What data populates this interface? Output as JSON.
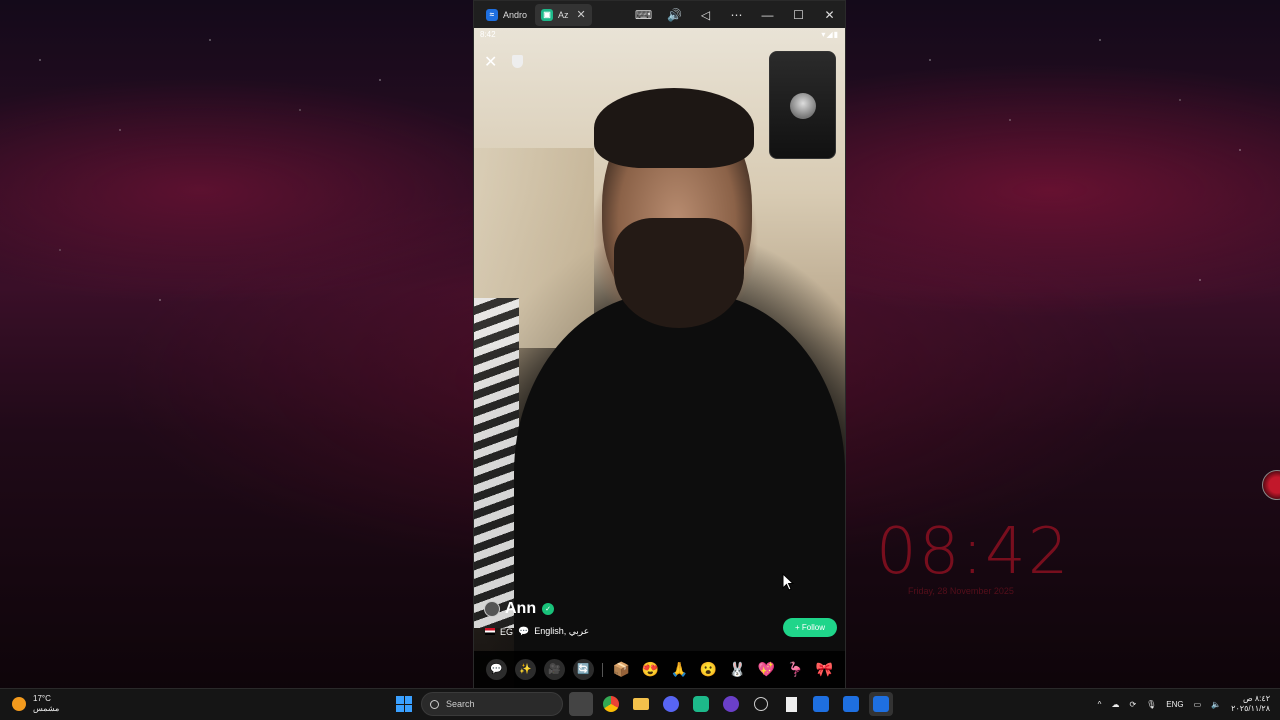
{
  "window": {
    "tabs": [
      {
        "label": "Andro",
        "icon": "android-emulator-icon"
      },
      {
        "label": "Az",
        "icon": "azar-app-icon"
      }
    ],
    "tab_close": "✕",
    "controls": [
      "⌨",
      "🔊",
      "◁",
      "⋯",
      "—",
      "☐",
      "✕"
    ]
  },
  "phone": {
    "time": "8:42",
    "status_icons": "▾◢▮",
    "close_glyph": "✕",
    "user": {
      "name": "Ann",
      "country": "EG",
      "languages": "English, عربي"
    },
    "follow_label": "+ Follow",
    "actions": [
      "💬",
      "✨",
      "🎥",
      "🔄"
    ],
    "gifts": [
      "📦",
      "😍",
      "🙏",
      "😮",
      "🐰",
      "💖",
      "🦩",
      "🎀"
    ]
  },
  "desktop": {
    "clock": "08:42",
    "clock_sub": "Friday, 28 November 2025"
  },
  "taskbar": {
    "weather_temp": "17°C",
    "weather_desc": "مشمس",
    "search_placeholder": "Search",
    "lang": "ENG",
    "time": "٨:٤٢ ص",
    "date": "٢٠٢٥/١١/٢٨",
    "colors": {
      "accent": "#3aa0ff",
      "follow": "#1fd58a"
    }
  }
}
